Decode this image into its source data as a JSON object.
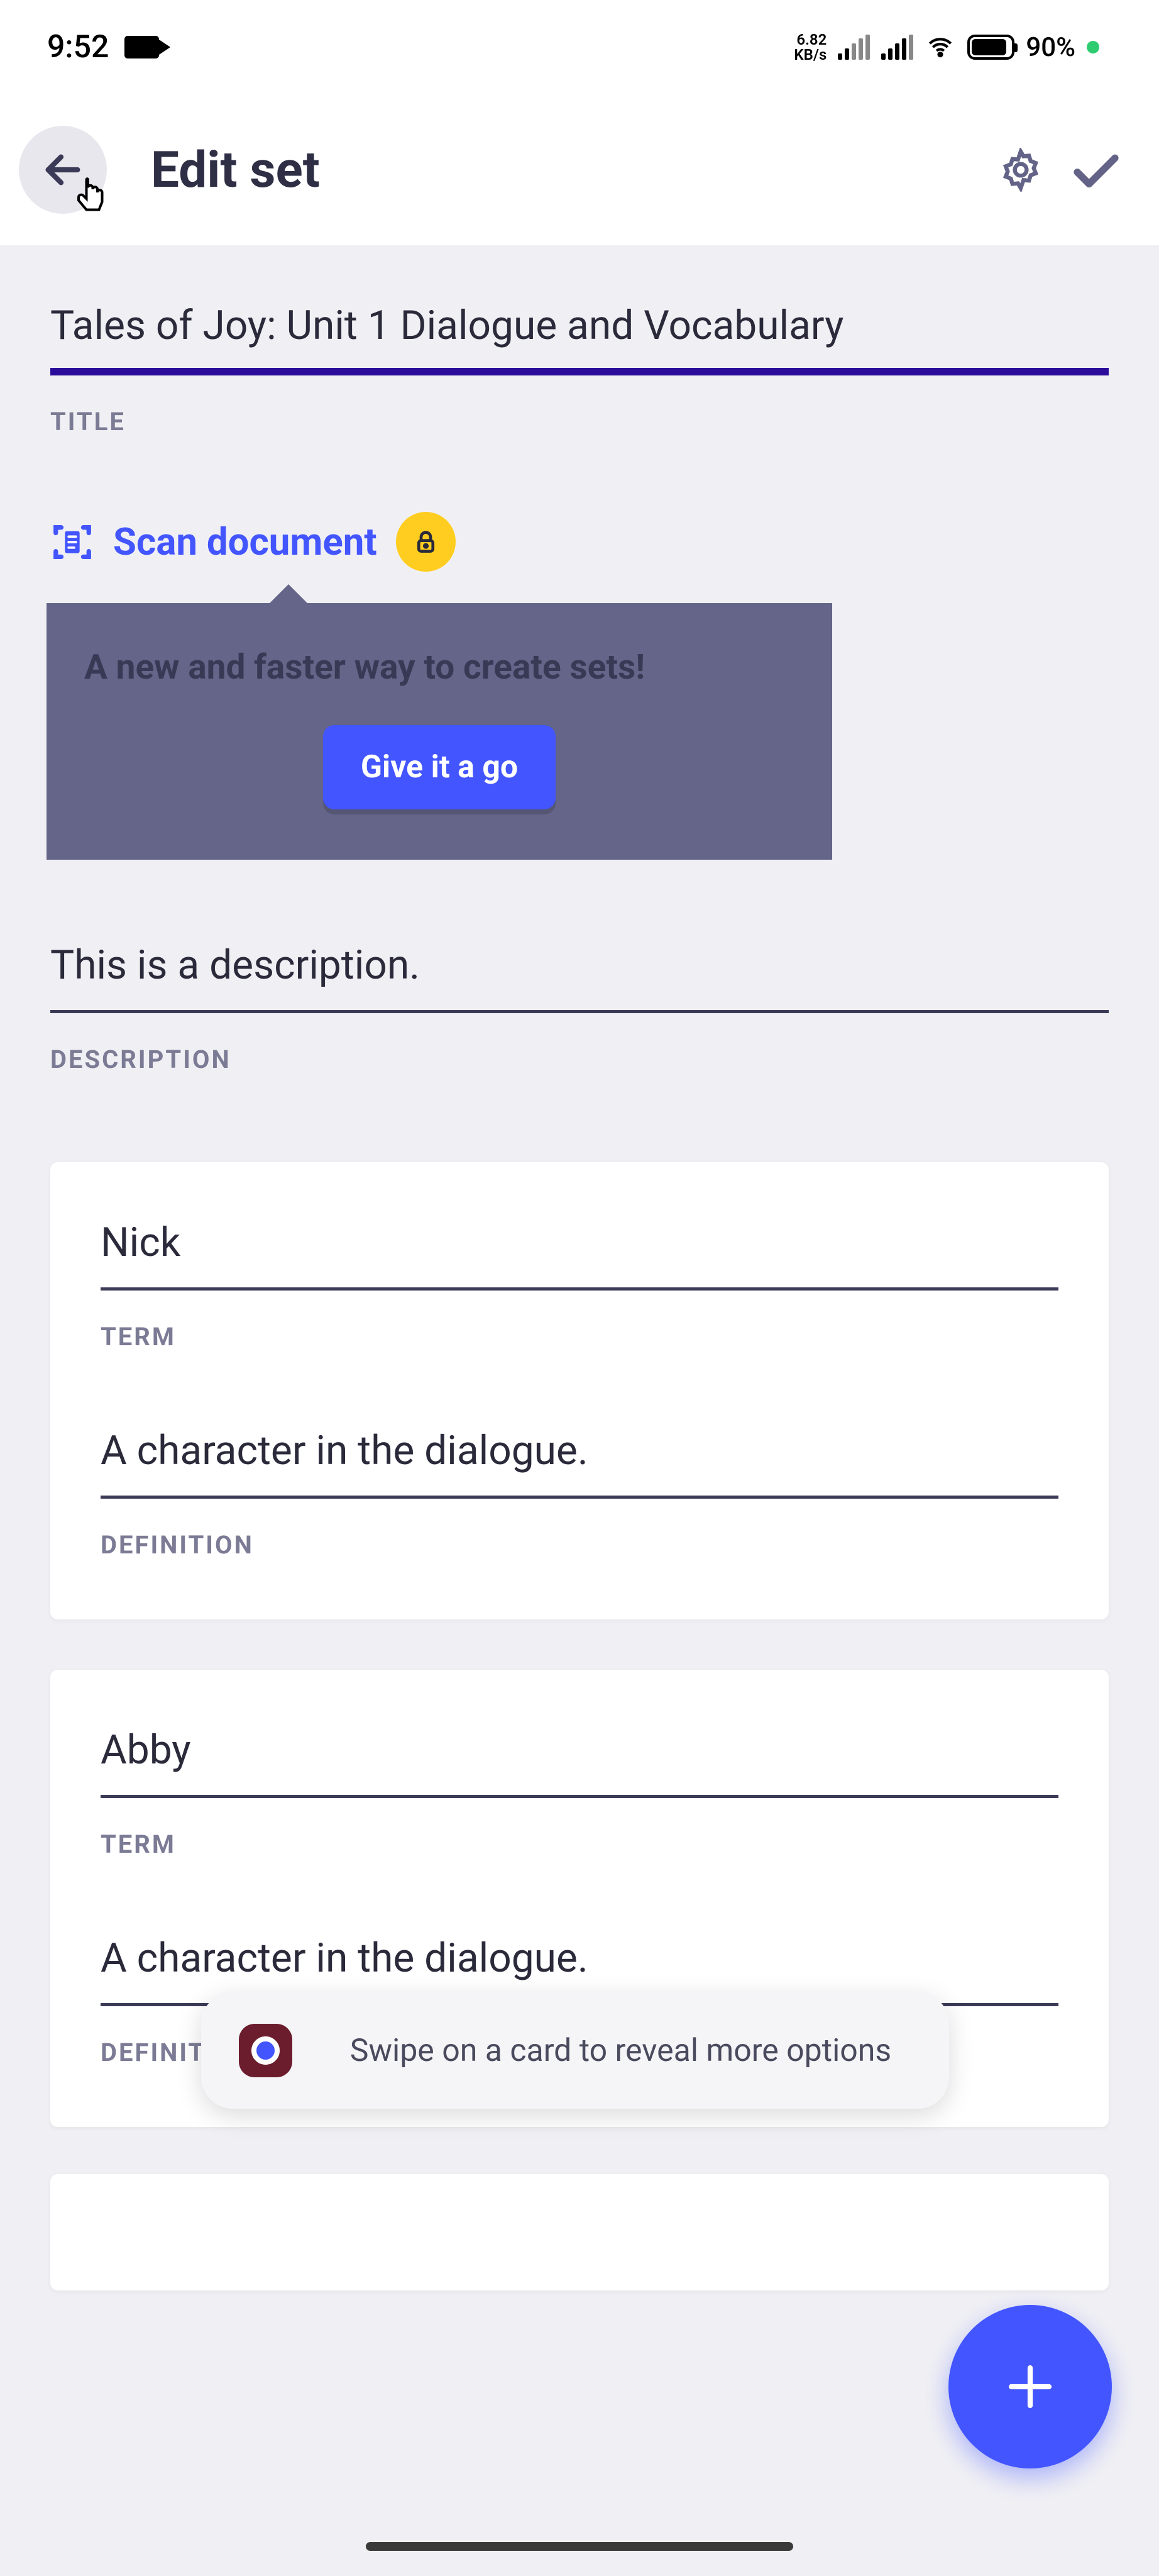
{
  "status": {
    "time": "9:52",
    "kbs_top": "6.82",
    "kbs_bot": "KB/s",
    "battery_pct": "90%"
  },
  "header": {
    "title": "Edit set"
  },
  "fields": {
    "title_value": "Tales of Joy: Unit 1 Dialogue and Vocabulary",
    "title_label": "TITLE",
    "description_value": "This is a description.",
    "description_label": "DESCRIPTION"
  },
  "scan": {
    "label": "Scan document",
    "tooltip": "A new and faster way to create sets!",
    "cta": "Give it a go"
  },
  "cards": [
    {
      "term": "Nick",
      "term_label": "TERM",
      "definition": "A character in the dialogue.",
      "definition_label": "DEFINITION"
    },
    {
      "term": "Abby",
      "term_label": "TERM",
      "definition": "A character in the dialogue.",
      "definition_label": "DEFINITION"
    }
  ],
  "toast": {
    "text": "Swipe on a card to reveal more options"
  },
  "colors": {
    "accent": "#4255ff",
    "underline": "#2b0c9a",
    "tooltip_bg": "#646588",
    "lock_bg": "#ffcd1f"
  }
}
